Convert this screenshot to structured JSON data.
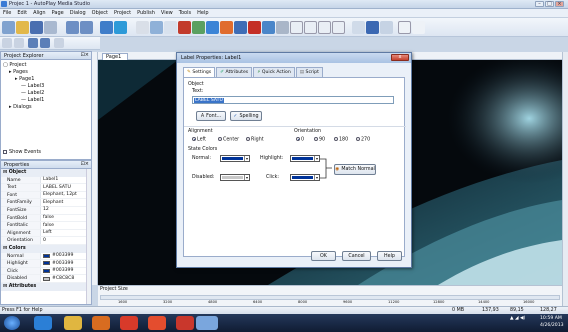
{
  "window": {
    "title": "Projec 1 - AutoPlay Media Studio"
  },
  "menu": [
    "File",
    "Edit",
    "Align",
    "Page",
    "Dialog",
    "Object",
    "Project",
    "Publish",
    "View",
    "Tools",
    "Help"
  ],
  "project_explorer": {
    "title": "Project Explorer",
    "tree": [
      {
        "label": "Project",
        "indent": 0
      },
      {
        "label": "Pages",
        "indent": 1
      },
      {
        "label": "Page1",
        "indent": 2
      },
      {
        "label": "Label3",
        "indent": 3
      },
      {
        "label": "Label2",
        "indent": 3
      },
      {
        "label": "Label1",
        "indent": 3
      },
      {
        "label": "Dialogs",
        "indent": 1
      }
    ],
    "show_events": "Show Events"
  },
  "properties": {
    "title": "Properties",
    "categories": [
      {
        "name": "Object",
        "rows": [
          {
            "k": "Name",
            "v": "Label1"
          },
          {
            "k": "Text",
            "v": "LABEL SATU"
          },
          {
            "k": "Font",
            "v": "Elephant, 12pt"
          },
          {
            "k": "FontFamily",
            "v": "Elephant"
          },
          {
            "k": "FontSize",
            "v": "12"
          },
          {
            "k": "FontBold",
            "v": "false"
          },
          {
            "k": "FontItalic",
            "v": "false"
          },
          {
            "k": "Alignment",
            "v": "Left"
          },
          {
            "k": "Orientation",
            "v": "0"
          }
        ]
      },
      {
        "name": "Colors",
        "rows": [
          {
            "k": "Normal",
            "v": "#003399",
            "color": "#003399"
          },
          {
            "k": "Highlight",
            "v": "#003399",
            "color": "#003399"
          },
          {
            "k": "Click",
            "v": "#003399",
            "color": "#003399"
          },
          {
            "k": "Disabled",
            "v": "#C8C8C8",
            "color": "#C8C8C8"
          }
        ]
      },
      {
        "name": "Attributes",
        "rows": []
      }
    ]
  },
  "doc_tab": "Page1",
  "ruler_labels": [
    "1600",
    "3200",
    "4800",
    "6400",
    "8000",
    "9600",
    "11200",
    "12800",
    "14400",
    "16000"
  ],
  "project_size": "Project Size",
  "dialog": {
    "title": "Label Properties: Label1",
    "close": "x",
    "tabs": [
      "Settings",
      "Attributes",
      "Quick Action",
      "Script"
    ],
    "object_label": "Object",
    "text_label": "Text:",
    "text_value": "LABEL SATU",
    "font_btn": "Font...",
    "spelling_btn": "Spelling",
    "alignment_label": "Alignment",
    "alignment_opts": [
      "Left",
      "Center",
      "Right"
    ],
    "orientation_label": "Orientation",
    "orientation_opts": [
      "0",
      "90",
      "180",
      "270"
    ],
    "state_colors_label": "State Colors",
    "normal_label": "Normal:",
    "highlight_label": "Highlight:",
    "disabled_label": "Disabled:",
    "click_label": "Click:",
    "match_btn": "Match Normal",
    "ok": "OK",
    "cancel": "Cancel",
    "help": "Help",
    "colors": {
      "normal": "#003399",
      "highlight": "#003399",
      "disabled": "#c8c8c8",
      "click": "#003399"
    }
  },
  "status": {
    "left": "Press F1 for Help",
    "size": "0 MB",
    "pos": "137,93",
    "dim": "89,15",
    "time": "10:59 AM",
    "date": "4/26/2013",
    "right_coord": "128,27"
  },
  "colors": {
    "accent": "#003399",
    "canvas": "#000000"
  }
}
